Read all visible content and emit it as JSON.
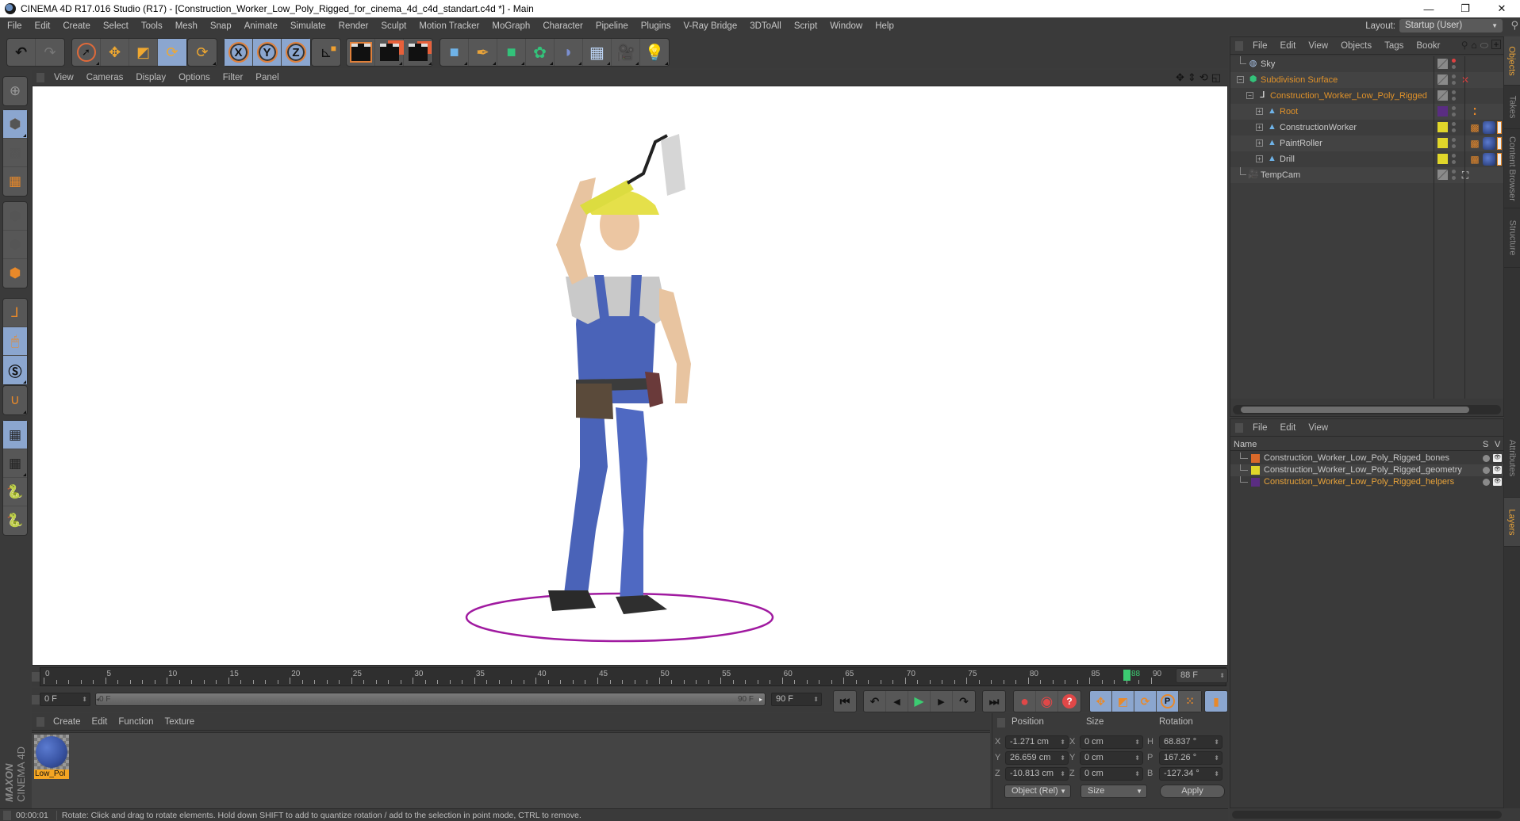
{
  "window": {
    "title": "CINEMA 4D R17.016 Studio (R17) - [Construction_Worker_Low_Poly_Rigged_for_cinema_4d_c4d_standart.c4d *] - Main",
    "controls": {
      "minimize": "—",
      "restore": "❐",
      "close": "✕"
    }
  },
  "menubar": {
    "items": [
      "File",
      "Edit",
      "Create",
      "Select",
      "Tools",
      "Mesh",
      "Snap",
      "Animate",
      "Simulate",
      "Render",
      "Sculpt",
      "Motion Tracker",
      "MoGraph",
      "Character",
      "Pipeline",
      "Plugins",
      "V-Ray Bridge",
      "3DToAll",
      "Script",
      "Window",
      "Help"
    ],
    "layout_label": "Layout:",
    "layout_value": "Startup (User)"
  },
  "toolbar": {
    "undo": "↶",
    "redo": "↷",
    "tools": [
      {
        "name": "live-selection",
        "glyph": "➚",
        "active": false
      },
      {
        "name": "move",
        "glyph": "✥",
        "active": false
      },
      {
        "name": "scale",
        "glyph": "◩",
        "active": false
      },
      {
        "name": "rotate",
        "glyph": "⟳",
        "active": true
      },
      {
        "name": "recent-tool",
        "glyph": "⟳",
        "active": false
      }
    ],
    "axes": [
      "X",
      "Y",
      "Z"
    ],
    "coord_system": "⊾",
    "render": [
      "🎬",
      "🎬",
      "🎬"
    ],
    "objects": [
      {
        "name": "cube",
        "glyph": "■",
        "color": "#6fb3e8"
      },
      {
        "name": "pen",
        "glyph": "✒",
        "color": "#e8a33a"
      },
      {
        "name": "subdivision",
        "glyph": "■",
        "color": "#33c27a"
      },
      {
        "name": "array",
        "glyph": "✿",
        "color": "#33c27a"
      },
      {
        "name": "deformer",
        "glyph": "◗",
        "color": "#7b8fd0"
      },
      {
        "name": "floor",
        "glyph": "▦",
        "color": "#bcd4f5"
      },
      {
        "name": "camera",
        "glyph": "🎥",
        "color": "#111111"
      },
      {
        "name": "light",
        "glyph": "💡",
        "color": "#eeeeee"
      }
    ]
  },
  "left_toolbar": {
    "items": [
      "make-editable",
      "model-mode",
      "texture-mode",
      "workplane-mode",
      "points-mode",
      "edges-mode",
      "polygons-mode",
      "axis-mode",
      "tweak-mode",
      "snap",
      "magnet",
      "lock-workplane",
      "workplane-rotate",
      "python-1",
      "python-2"
    ],
    "brand_top": "MAXON",
    "brand_bottom": "CINEMA 4D"
  },
  "viewport": {
    "menu": [
      "View",
      "Cameras",
      "Display",
      "Options",
      "Filter",
      "Panel"
    ],
    "nav_icons": [
      "move-view",
      "dolly-view",
      "rotate-view",
      "toggle-view"
    ]
  },
  "timeline": {
    "start": 0,
    "end": 90,
    "major_ticks": [
      0,
      5,
      10,
      15,
      20,
      25,
      30,
      35,
      40,
      45,
      50,
      55,
      60,
      65,
      70,
      75,
      80,
      85,
      90
    ],
    "current_frame": 88,
    "current_frame_label": "88",
    "current_frame_field": "88 F",
    "start_field": "0 F",
    "range_start": "0 F",
    "range_end": "90 F",
    "end_field": "90 F"
  },
  "transport": {
    "goto_start": "⏮",
    "prev_key": "↶",
    "prev_frame": "◀",
    "play": "▶",
    "next_frame": "▶",
    "next_key": "↷",
    "goto_end": "⏭",
    "record": "●",
    "autokey": "◉",
    "keyframe_sel": "?",
    "play_color": "#3ccc72"
  },
  "material_manager": {
    "menu": [
      "Create",
      "Edit",
      "Function",
      "Texture"
    ],
    "materials": [
      {
        "name": "Low_Pol"
      }
    ]
  },
  "coordinates": {
    "headers": {
      "position": "Position",
      "size": "Size",
      "rotation": "Rotation"
    },
    "position": [
      {
        "axis": "X",
        "value": "-1.271 cm"
      },
      {
        "axis": "Y",
        "value": "26.659 cm"
      },
      {
        "axis": "Z",
        "value": "-10.813 cm"
      }
    ],
    "size": [
      {
        "axis": "X",
        "value": "0 cm"
      },
      {
        "axis": "Y",
        "value": "0 cm"
      },
      {
        "axis": "Z",
        "value": "0 cm"
      }
    ],
    "rotation": [
      {
        "axis": "H",
        "value": "68.837 °"
      },
      {
        "axis": "P",
        "value": "167.26 °"
      },
      {
        "axis": "B",
        "value": "-127.34 °"
      }
    ],
    "mode": "Object (Rel)",
    "size_mode": "Size",
    "apply": "Apply"
  },
  "statusbar": {
    "time": "00:00:01",
    "message": "Rotate: Click and drag to rotate elements. Hold down SHIFT to add to quantize rotation / add to the selection in point mode, CTRL to remove."
  },
  "object_manager": {
    "menu": [
      "File",
      "Edit",
      "View",
      "Objects",
      "Tags",
      "Bookr"
    ],
    "objects": [
      {
        "name": "Sky",
        "depth": 0,
        "icon": "sky",
        "color": "#c8c8c8",
        "expandable": false,
        "vis": "gray",
        "tags": []
      },
      {
        "name": "Subdivision Surface",
        "depth": 0,
        "icon": "subdivision",
        "color": "#e0922a",
        "expandable": true,
        "vis": "gray",
        "tags": [
          "x"
        ]
      },
      {
        "name": "Construction_Worker_Low_Poly_Rigged",
        "depth": 1,
        "icon": "null",
        "color": "#e0922a",
        "expandable": true,
        "vis": "gray",
        "tags": []
      },
      {
        "name": "Root",
        "depth": 2,
        "icon": "joint",
        "color": "#e0922a",
        "expandable": true,
        "vis": "#5a2d82",
        "tags": [
          "bones"
        ]
      },
      {
        "name": "ConstructionWorker",
        "depth": 2,
        "icon": "joint",
        "color": "#c8c8c8",
        "expandable": true,
        "vis": "#e0d62a",
        "tags": [
          "weight",
          "material",
          "uvw"
        ]
      },
      {
        "name": "PaintRoller",
        "depth": 2,
        "icon": "joint",
        "color": "#c8c8c8",
        "expandable": true,
        "vis": "#e0d62a",
        "tags": [
          "weight",
          "material",
          "uvw"
        ]
      },
      {
        "name": "Drill",
        "depth": 2,
        "icon": "joint",
        "color": "#c8c8c8",
        "expandable": true,
        "vis": "#e0d62a",
        "tags": [
          "weight",
          "material",
          "uvw"
        ]
      },
      {
        "name": "TempCam",
        "depth": 0,
        "icon": "camera",
        "color": "#c8c8c8",
        "expandable": false,
        "vis": "gray",
        "tags": [
          "target"
        ]
      }
    ]
  },
  "layer_manager": {
    "menu": [
      "File",
      "Edit",
      "View"
    ],
    "columns": {
      "name": "Name",
      "s": "S",
      "v": "V"
    },
    "layers": [
      {
        "name": "Construction_Worker_Low_Poly_Rigged_bones",
        "color": "#d9692a",
        "text_color": "#c8c8c8"
      },
      {
        "name": "Construction_Worker_Low_Poly_Rigged_geometry",
        "color": "#e0d62a",
        "text_color": "#c8c8c8"
      },
      {
        "name": "Construction_Worker_Low_Poly_Rigged_helpers",
        "color": "#5a2d82",
        "text_color": "#e8a33a"
      }
    ]
  },
  "side_tabs": {
    "top": [
      {
        "label": "Objects",
        "active": true
      },
      {
        "label": "Takes",
        "active": false
      },
      {
        "label": "Content Browser",
        "active": false
      },
      {
        "label": "Structure",
        "active": false
      }
    ],
    "bottom": [
      {
        "label": "Attributes",
        "active": false
      },
      {
        "label": "Layers",
        "active": true
      }
    ]
  }
}
